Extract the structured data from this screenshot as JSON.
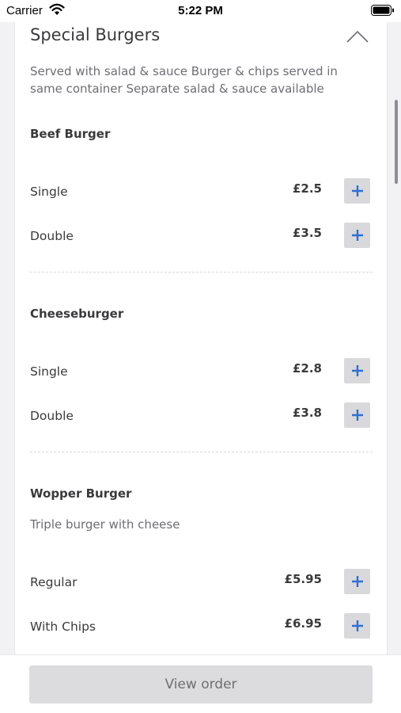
{
  "status_bar": {
    "carrier": "Carrier",
    "time": "5:22 PM"
  },
  "section": {
    "title": "Special Burgers",
    "description": "Served with salad & sauce Burger & chips served in same container Separate salad & sauce available"
  },
  "groups": [
    {
      "title": "Beef Burger",
      "items": [
        {
          "name": "Single",
          "price": "£2.5"
        },
        {
          "name": "Double",
          "price": "£3.5"
        }
      ]
    },
    {
      "title": "Cheeseburger",
      "items": [
        {
          "name": "Single",
          "price": "£2.8"
        },
        {
          "name": "Double",
          "price": "£3.8"
        }
      ]
    },
    {
      "title": "Wopper Burger",
      "description": "Triple burger with cheese",
      "items": [
        {
          "name": "Regular",
          "price": "£5.95"
        },
        {
          "name": "With Chips",
          "price": "£6.95"
        }
      ]
    }
  ],
  "bottom": {
    "view_order_label": "View order"
  },
  "colors": {
    "accent": "#2f6fd1",
    "button_bg": "#d9d9dc",
    "text": "#3a3a3c",
    "muted": "#6e6e73"
  },
  "icons": [
    "wifi-icon",
    "battery-icon",
    "chevron-up-icon",
    "plus-icon"
  ]
}
